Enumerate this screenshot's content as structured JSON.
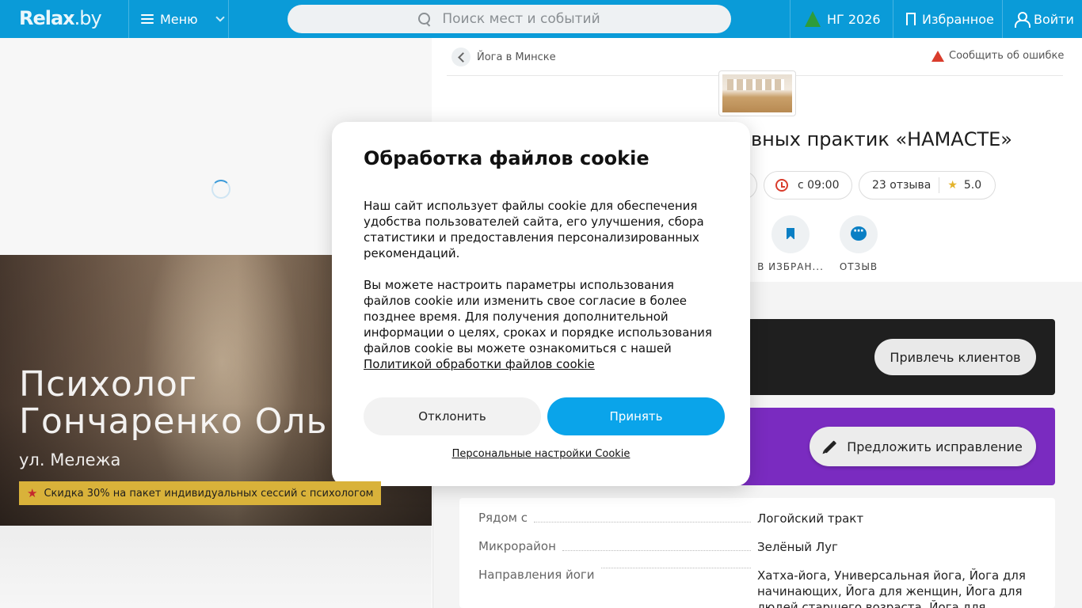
{
  "header": {
    "logo_text": "Relax",
    "logo_suffix": ".by",
    "menu_label": "Меню",
    "search_placeholder": "Поиск мест и событий",
    "ny_label": "НГ 2026",
    "favorites_label": "Избранное",
    "login_label": "Войти",
    "brand_color": "#0a9bd8"
  },
  "promo": {
    "title_line1": "Психолог",
    "title_line2": "Гончаренко Оль",
    "address": "ул. Мележа",
    "badge": "Скидка 30% на пакет индивидуальных сессий с психологом"
  },
  "place": {
    "breadcrumb": "Йога в Минске",
    "report": "Сообщить об ошибке",
    "title_visible": "вных практик «НАМАСТЕ»",
    "hours": "с 09:00",
    "reviews": "23 отзыва",
    "rating": "5.0",
    "actions": [
      {
        "label": "В ИЗБРАН...",
        "icon": "bookmark-icon"
      },
      {
        "label": "ОТЗЫВ",
        "icon": "chat-icon"
      }
    ],
    "attract_button": "Привлечь клиентов",
    "suggest_button": "Предложить исправление",
    "info": [
      {
        "key": "Рядом с",
        "value": "Логойский тракт"
      },
      {
        "key": "Микрорайон",
        "value": "Зелёный Луг"
      },
      {
        "key": "Направления йоги",
        "value": "Хатха-йога, Универсальная йога, Йога для начинающих, Йога для женщин, Йога для людей старшего возраста, Йога для"
      }
    ]
  },
  "cookie_modal": {
    "title": "Обработка файлов cookie",
    "paragraph1": "Наш сайт использует файлы cookie для обеспечения удобства пользователей сайта, его улучшения, сбора статистики и предоставления персонализированных рекомендаций.",
    "paragraph2": "Вы можете настроить параметры использования файлов cookie или изменить свое согласие в более позднее время. Для получения дополнительной информации о целях, сроках и порядке использования файлов cookie вы можете ознакомиться с нашей",
    "policy_link": "Политикой обработки файлов cookie",
    "decline": "Отклонить",
    "accept": "Принять",
    "settings_link": "Персональные настройки Cookie",
    "accent_color": "#0aa4ea"
  }
}
